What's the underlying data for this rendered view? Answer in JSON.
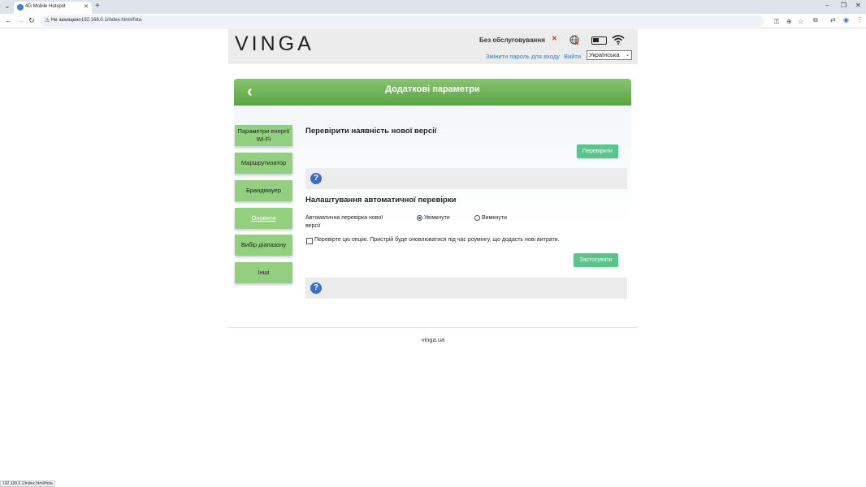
{
  "browser": {
    "tab_title": "4G Mobile Hotspot",
    "security_label": "Не захищено",
    "url": "192.168.0.1/index.html#fota",
    "status_url": "192.168.0.1/index.html#fota"
  },
  "header": {
    "logo": "VINGA",
    "status": "Без обслуговування",
    "change_password": "Змінити пароль для входу",
    "logout": "Вийти",
    "language": "Українська"
  },
  "banner": {
    "back": "‹",
    "title": "Додаткові параметри"
  },
  "sidebar": {
    "items": [
      {
        "label": "Параметри енергії Wi-Fi"
      },
      {
        "label": "Маршрутизатор"
      },
      {
        "label": "Брандмауер"
      },
      {
        "label": "Оновити"
      },
      {
        "label": "Вибір діапазону"
      },
      {
        "label": "Інші"
      }
    ]
  },
  "check_section": {
    "title": "Перевірити наявність нової версії",
    "button": "Перевірити"
  },
  "auto_section": {
    "title": "Налаштування автоматичної перевірки",
    "field_label": "Автоматична перевірка нової версії",
    "option_on": "Увімкнути",
    "option_off": "Вимкнути",
    "roaming_note": "Перевірте цю опцію. Пристрій буде оновлюватися під час роумінгу, що додасть нові витрати.",
    "apply": "Застосувати"
  },
  "help_icon": "?",
  "footer": "vinga.ua"
}
